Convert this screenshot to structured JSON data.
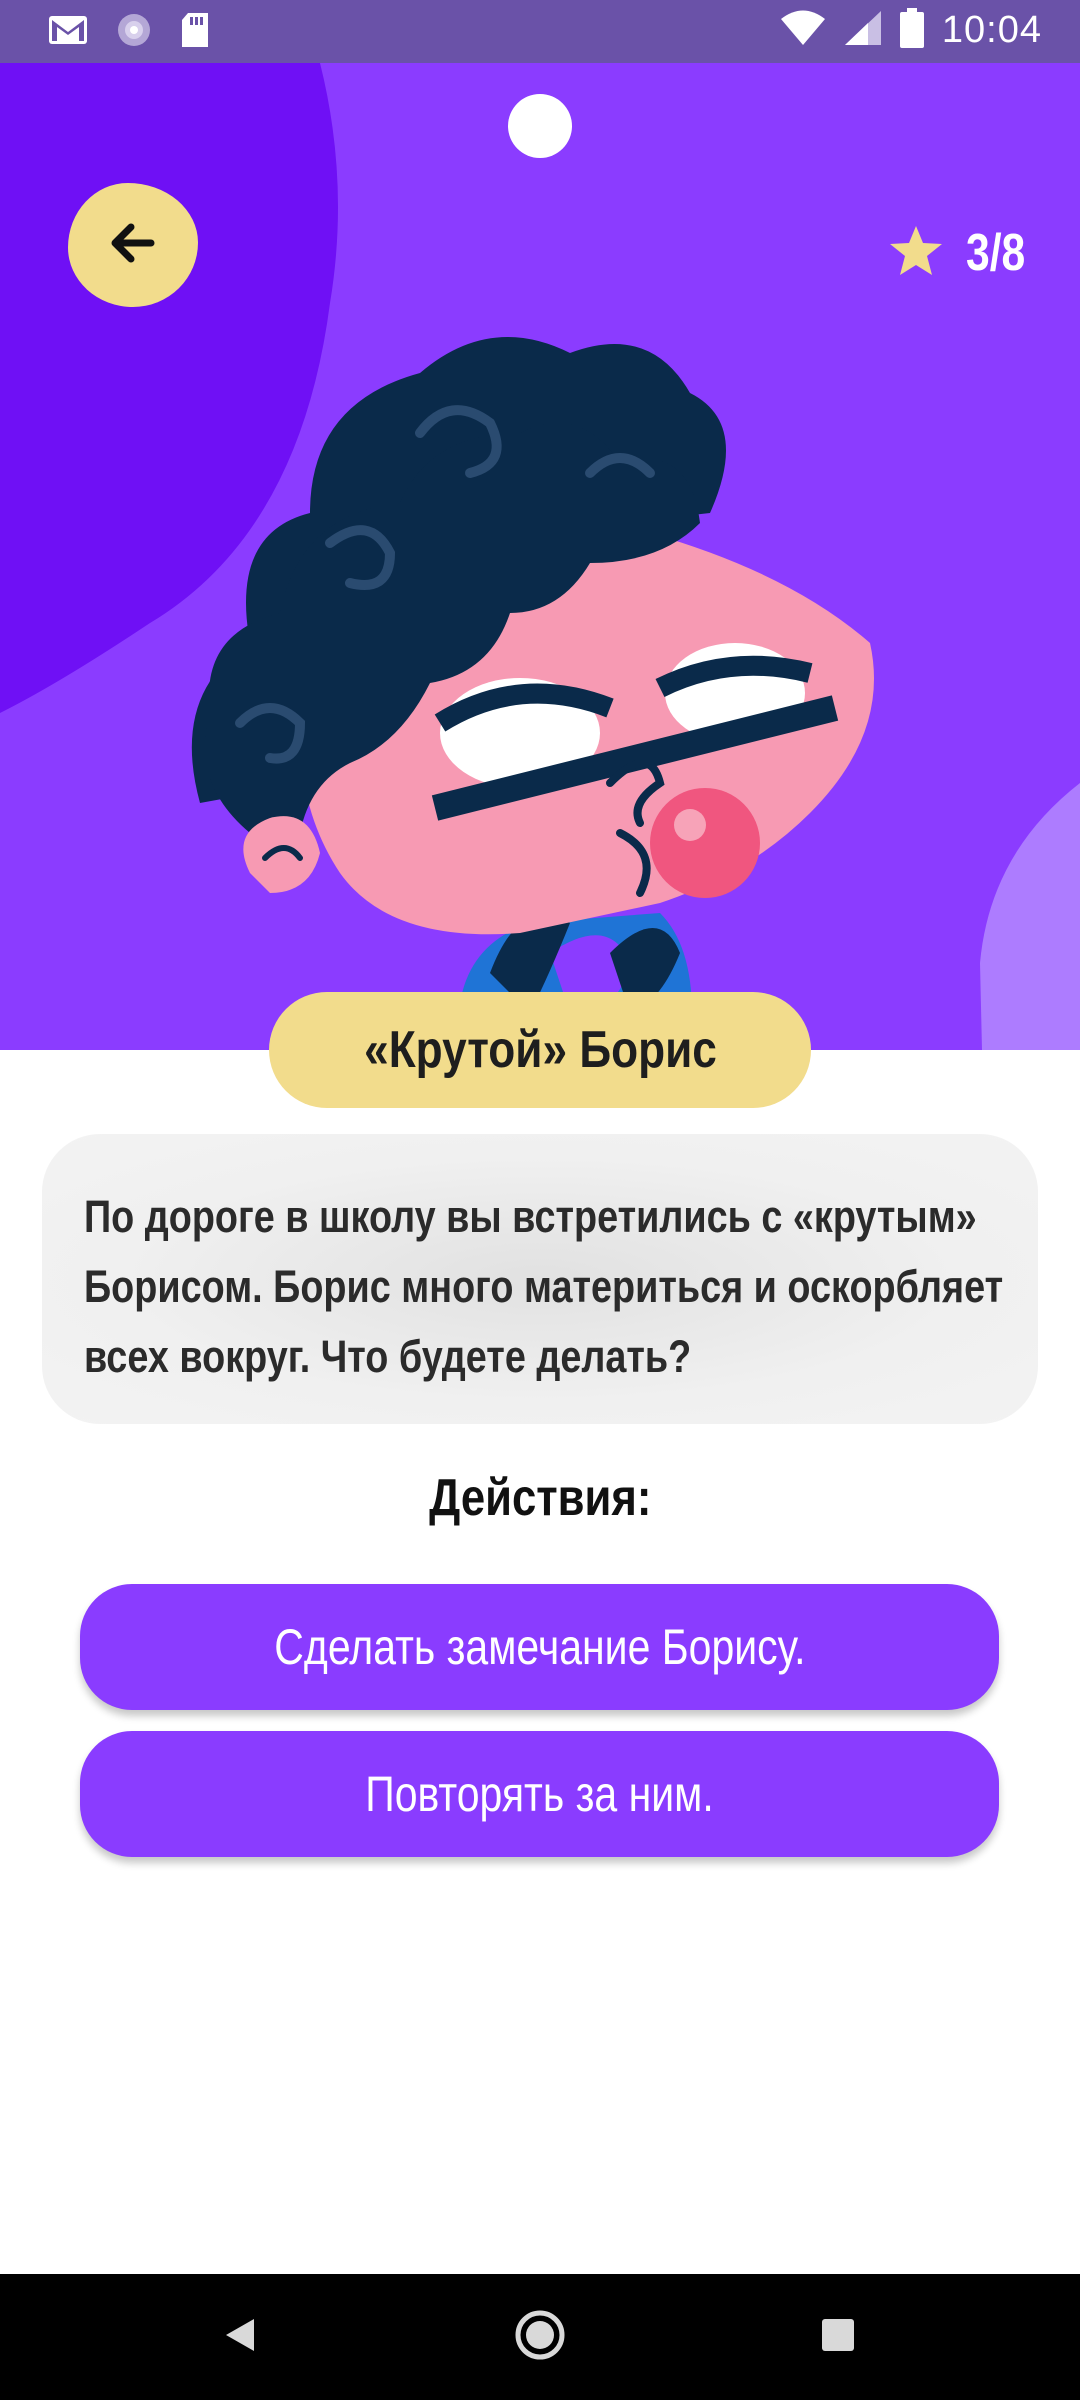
{
  "status_bar": {
    "time": "10:04",
    "left_icons": [
      "gmail-icon",
      "sync-icon",
      "sd-card-icon"
    ],
    "right_icons": [
      "wifi-icon",
      "signal-icon",
      "battery-icon"
    ]
  },
  "header": {
    "back_icon": "arrow-left-icon",
    "progress": "3/8",
    "progress_icon": "star-icon"
  },
  "scenario": {
    "title": "«Крутой» Борис",
    "description": "По дороге в школу вы встретились с «крутым» Борисом. Борис много материться и оскорбляет всех вокруг. Что будете делать?"
  },
  "actions": {
    "heading": "Действия:",
    "options": [
      {
        "label": "Сделать замечание Борису."
      },
      {
        "label": "Повторять за ним."
      }
    ]
  },
  "nav_bar": {
    "icons": [
      "back-triangle-icon",
      "home-circle-icon",
      "recents-square-icon"
    ]
  },
  "colors": {
    "status_bar": "#6a52a8",
    "hero_background": "#8b3cff",
    "hero_dark": "#6f10f5",
    "accent_yellow": "#f2dc8c",
    "button_purple": "#8a3cff",
    "card_gray": "#ececec",
    "nav_bar": "#000000"
  }
}
